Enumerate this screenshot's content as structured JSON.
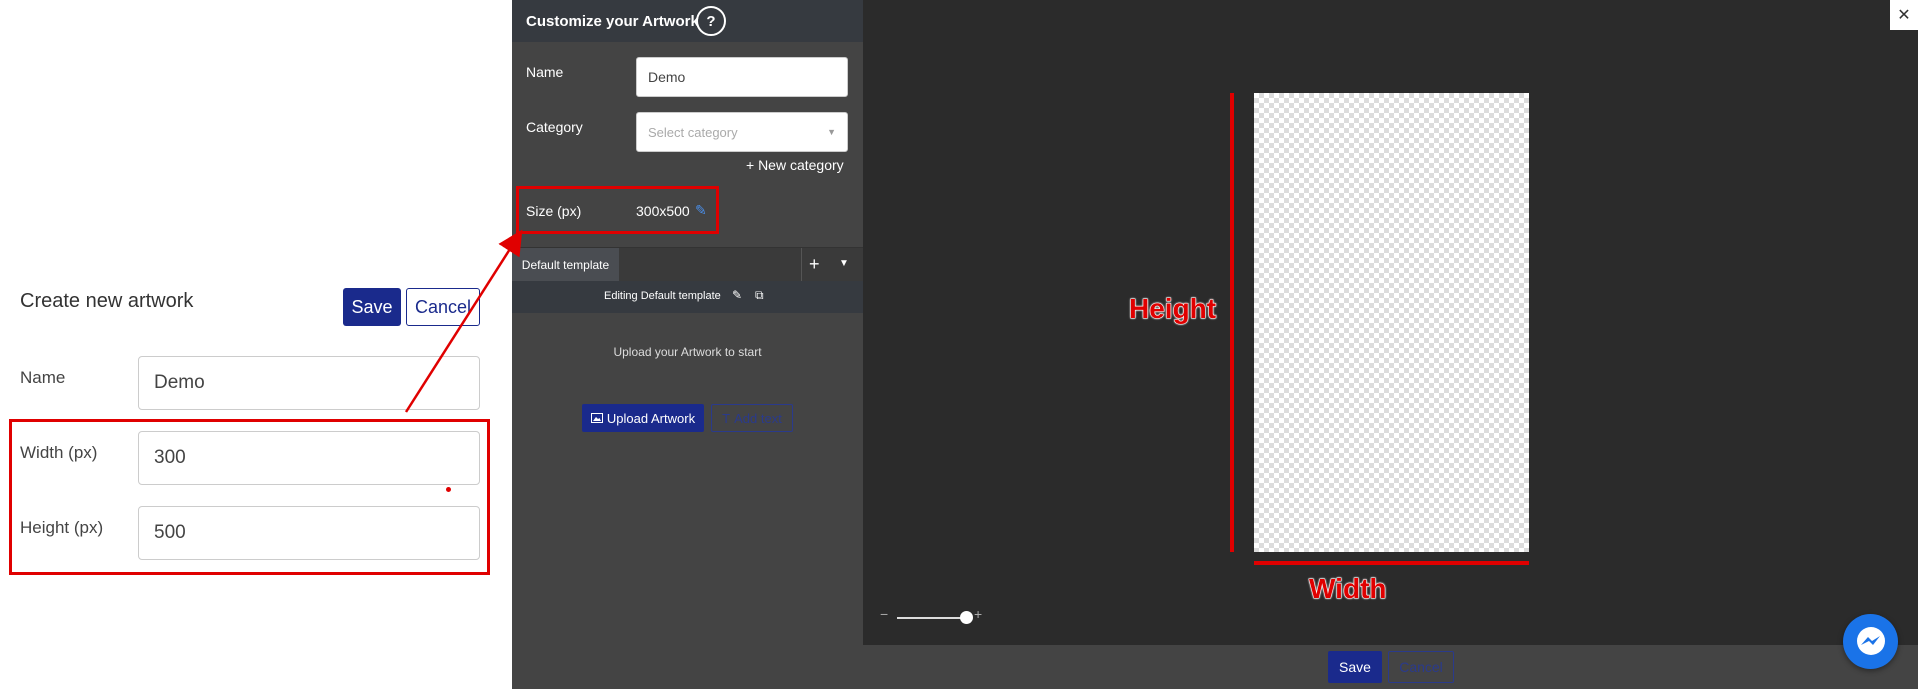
{
  "form": {
    "title": "Create new artwork",
    "save_label": "Save",
    "cancel_label": "Cancel",
    "name_label": "Name",
    "name_value": "Demo",
    "width_label": "Width (px)",
    "width_value": "300",
    "height_label": "Height (px)",
    "height_value": "500"
  },
  "panel": {
    "title": "Customize your Artwork",
    "help_glyph": "?",
    "name_label": "Name",
    "name_value": "Demo",
    "category_label": "Category",
    "category_placeholder": "Select category",
    "new_category_label": "+ New category",
    "size_label": "Size (px)",
    "size_value": "300x500",
    "tab_label": "Default template",
    "editing_label": "Editing Default template",
    "upload_hint": "Upload your Artwork to start",
    "upload_button": "Upload Artwork",
    "add_text_button": "Add text"
  },
  "canvas": {
    "height_annotation": "Height",
    "width_annotation": "Width"
  },
  "footer": {
    "save_label": "Save",
    "cancel_label": "Cancel"
  },
  "colors": {
    "primary": "#1a2a8c",
    "annotation": "#e00000",
    "panel_bg": "#444444",
    "canvas_bg": "#2b2b2b"
  }
}
